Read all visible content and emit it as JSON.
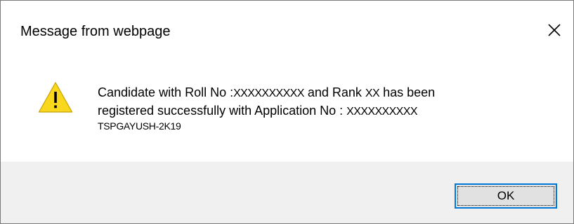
{
  "window": {
    "title": "Message from webpage"
  },
  "icons": {
    "close": "close-icon",
    "alert": "warning-icon",
    "alert_color": "#f9d71c"
  },
  "message": {
    "line1_prefix": "Candidate with Roll No :",
    "roll_no": "XXXXXXXXXX",
    "line1_mid": " and Rank ",
    "rank": "XX",
    "line1_suffix": " has been",
    "line2_prefix": "registered successfully with Application No : ",
    "application_no": "XXXXXXXXXX",
    "line3": "TSPGAYUSH-2K19"
  },
  "buttons": {
    "ok_label": "OK",
    "accent_color": "#0078d7"
  }
}
